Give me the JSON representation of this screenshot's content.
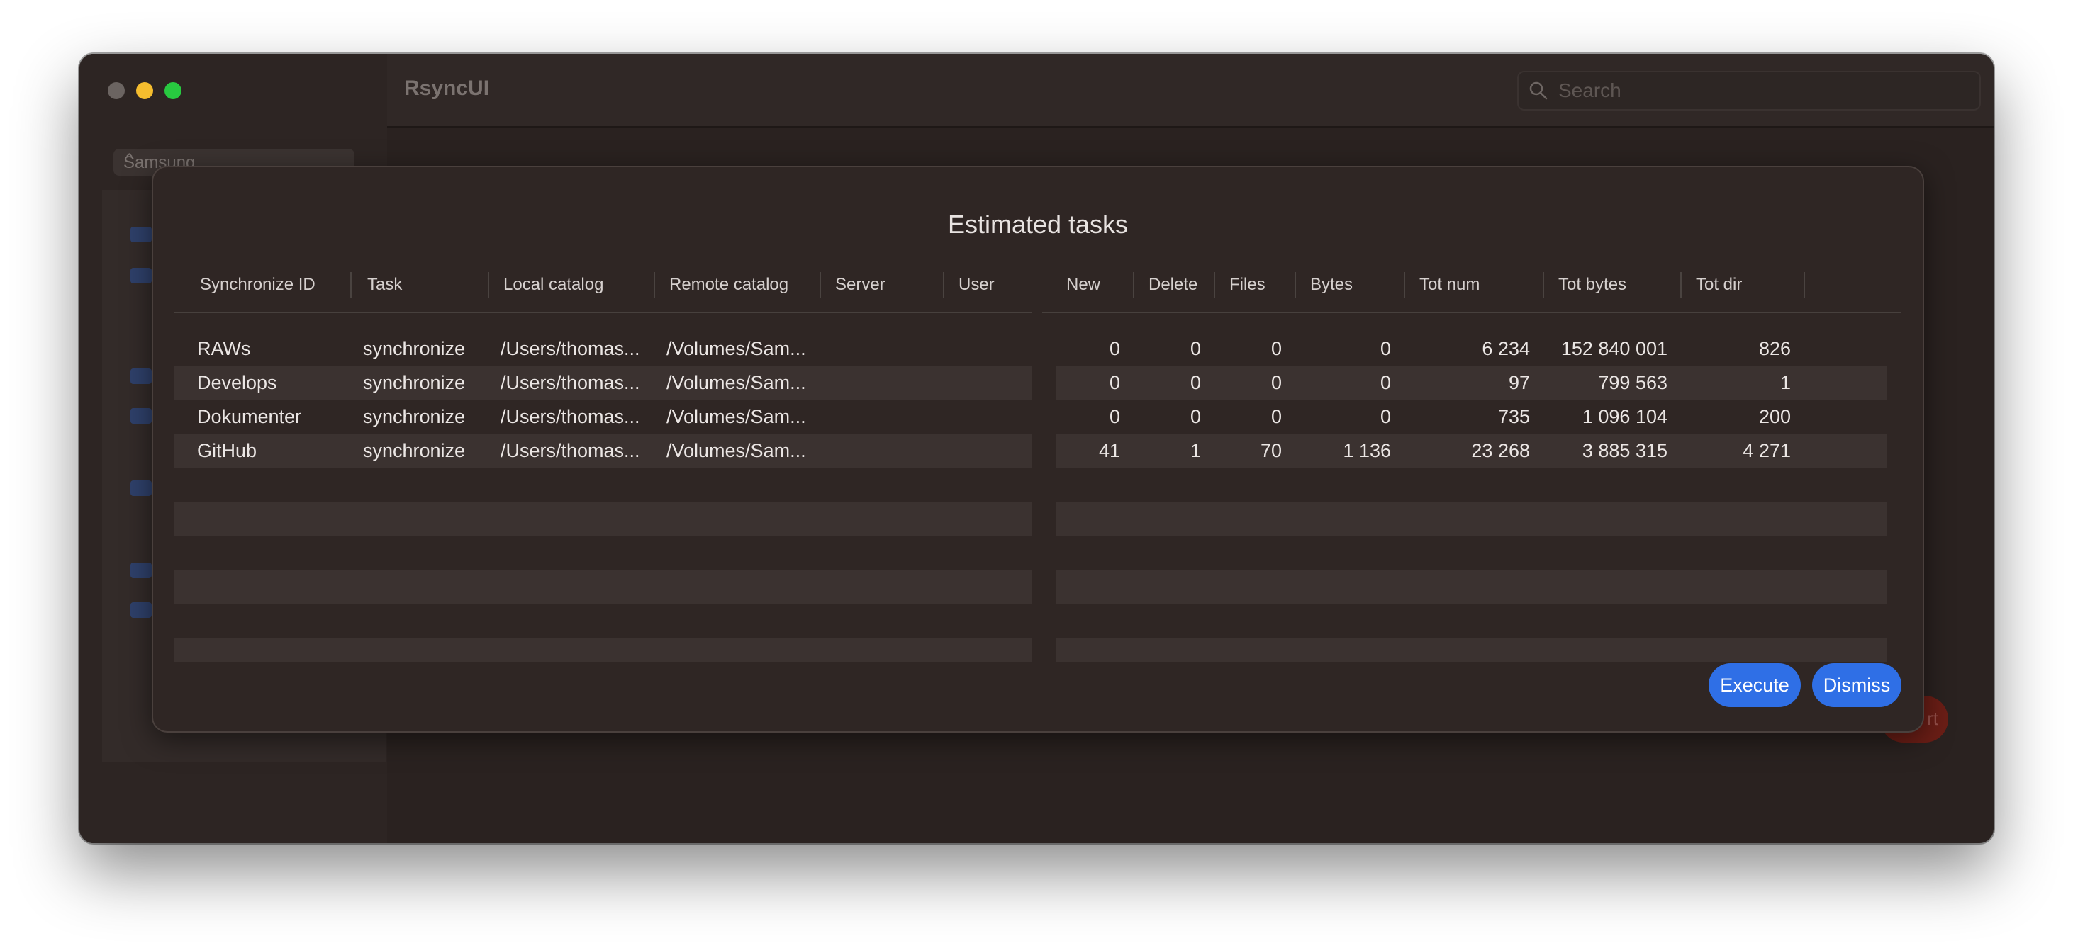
{
  "window": {
    "app_title": "RsyncUI",
    "traffic_lights": [
      "#6b6461",
      "#f5bd2e",
      "#28c940"
    ]
  },
  "search": {
    "placeholder": "Search"
  },
  "sidebar": {
    "profile": "Samsung"
  },
  "sheet": {
    "title": "Estimated tasks",
    "left_columns": [
      "Synchronize ID",
      "Task",
      "Local catalog",
      "Remote catalog",
      "Server",
      "User"
    ],
    "right_columns": [
      "New",
      "Delete",
      "Files",
      "Bytes",
      "Tot num",
      "Tot bytes",
      "Tot dir"
    ],
    "rows": [
      {
        "id": "RAWs",
        "task": "synchronize",
        "local": "/Users/thomas...",
        "remote": "/Volumes/Sam...",
        "server": "",
        "user": "",
        "new": "0",
        "delete": "0",
        "files": "0",
        "bytes": "0",
        "totnum": "6 234",
        "totbytes": "152 840 001",
        "totdir": "826"
      },
      {
        "id": "Develops",
        "task": "synchronize",
        "local": "/Users/thomas...",
        "remote": "/Volumes/Sam...",
        "server": "",
        "user": "",
        "new": "0",
        "delete": "0",
        "files": "0",
        "bytes": "0",
        "totnum": "97",
        "totbytes": "799 563",
        "totdir": "1"
      },
      {
        "id": "Dokumenter",
        "task": "synchronize",
        "local": "/Users/thomas...",
        "remote": "/Volumes/Sam...",
        "server": "",
        "user": "",
        "new": "0",
        "delete": "0",
        "files": "0",
        "bytes": "0",
        "totnum": "735",
        "totbytes": "1 096 104",
        "totdir": "200"
      },
      {
        "id": "GitHub",
        "task": "synchronize",
        "local": "/Users/thomas...",
        "remote": "/Volumes/Sam...",
        "server": "",
        "user": "",
        "new": "41",
        "delete": "1",
        "files": "70",
        "bytes": "1 136",
        "totnum": "23 268",
        "totbytes": "3 885 315",
        "totdir": "4 271"
      }
    ],
    "buttons": {
      "execute": "Execute",
      "dismiss": "Dismiss"
    },
    "accent_color": "#2f6fe6"
  }
}
